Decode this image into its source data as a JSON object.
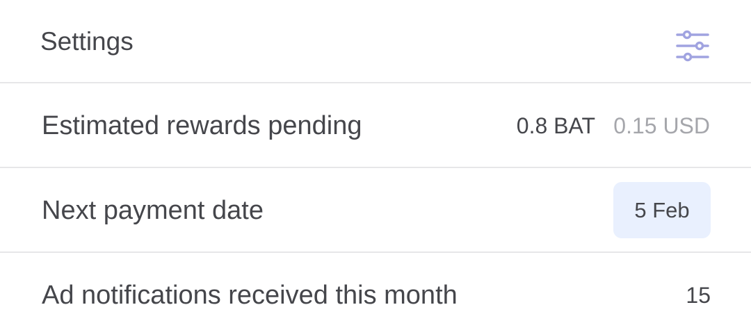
{
  "header": {
    "title": "Settings",
    "settings_icon": "sliders-icon",
    "accent_color": "#a0a3e0"
  },
  "rows": {
    "estimated_rewards": {
      "label": "Estimated rewards pending",
      "bat": "0.8 BAT",
      "usd": "0.15 USD"
    },
    "next_payment": {
      "label": "Next payment date",
      "date": "5 Feb",
      "badge_color": "#e9f0fe"
    },
    "ad_notifications": {
      "label": "Ad notifications received this month",
      "count": "15"
    }
  }
}
